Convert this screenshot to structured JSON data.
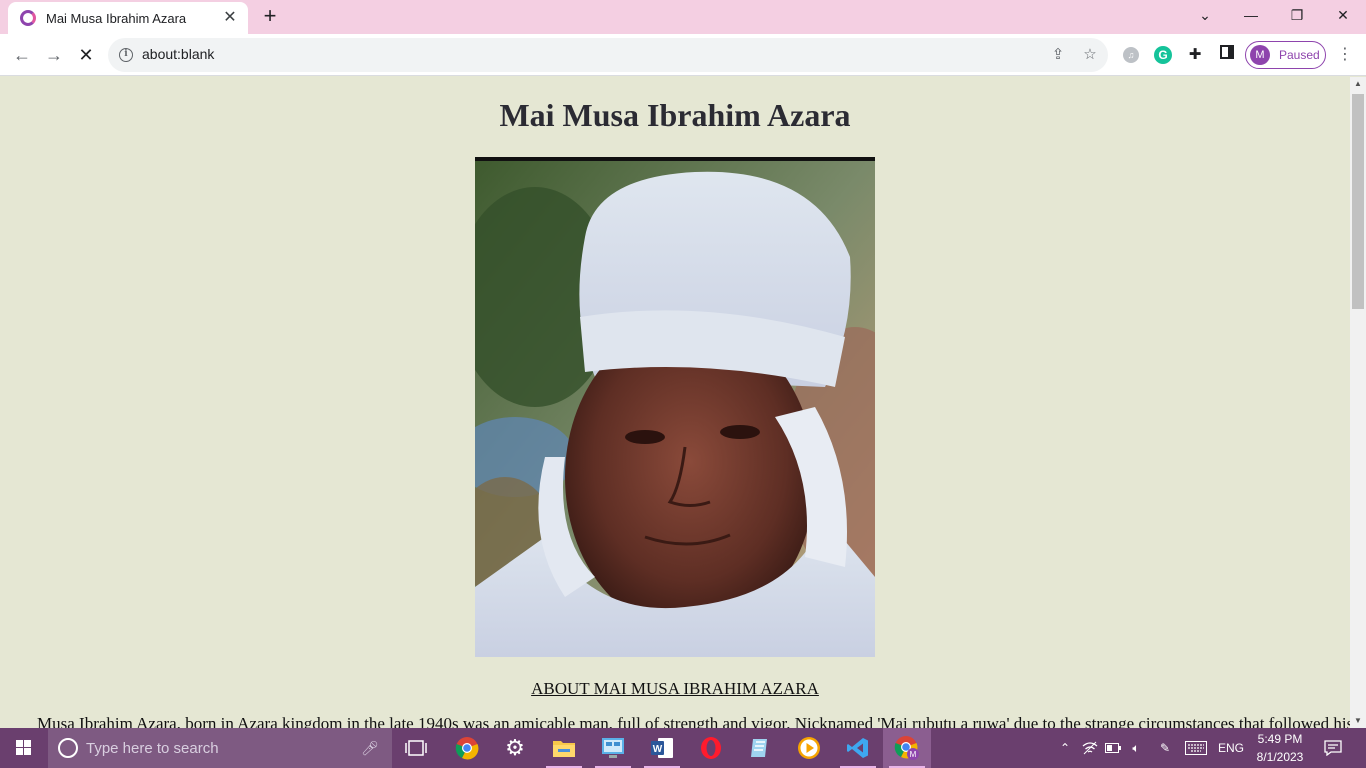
{
  "browser": {
    "tab": {
      "title": "Mai Musa Ibrahim Azara"
    },
    "address_bar": {
      "url": "about:blank"
    },
    "profile": {
      "initial": "M",
      "status": "Paused"
    }
  },
  "page": {
    "heading": "Mai Musa Ibrahim Azara",
    "photo": {
      "description": "portrait"
    },
    "about_link": "ABOUT MAI MUSA IBRAHIM AZARA",
    "bio_visible_text": "Musa Ibrahim Azara, born in Azara kingdom in the late 1940s was an amicable man, full of strength and vigor. Nicknamed 'Mai rubutu a ruwa' due to the strange circumstances that followed his early"
  },
  "taskbar": {
    "search_placeholder": "Type here to search",
    "apps": [
      "task-view",
      "chrome",
      "settings",
      "file-explorer",
      "control-panel",
      "word",
      "opera",
      "notepad",
      "media-player",
      "vscode",
      "chrome-profile"
    ],
    "tray": {
      "language": "ENG",
      "time": "5:49 PM",
      "date": "8/1/2023"
    }
  },
  "colors": {
    "titlebar": "#f4cfe2",
    "page_background": "#e5e7d3",
    "accent": "#8e44ad",
    "taskbar": "#6a3f6e"
  }
}
